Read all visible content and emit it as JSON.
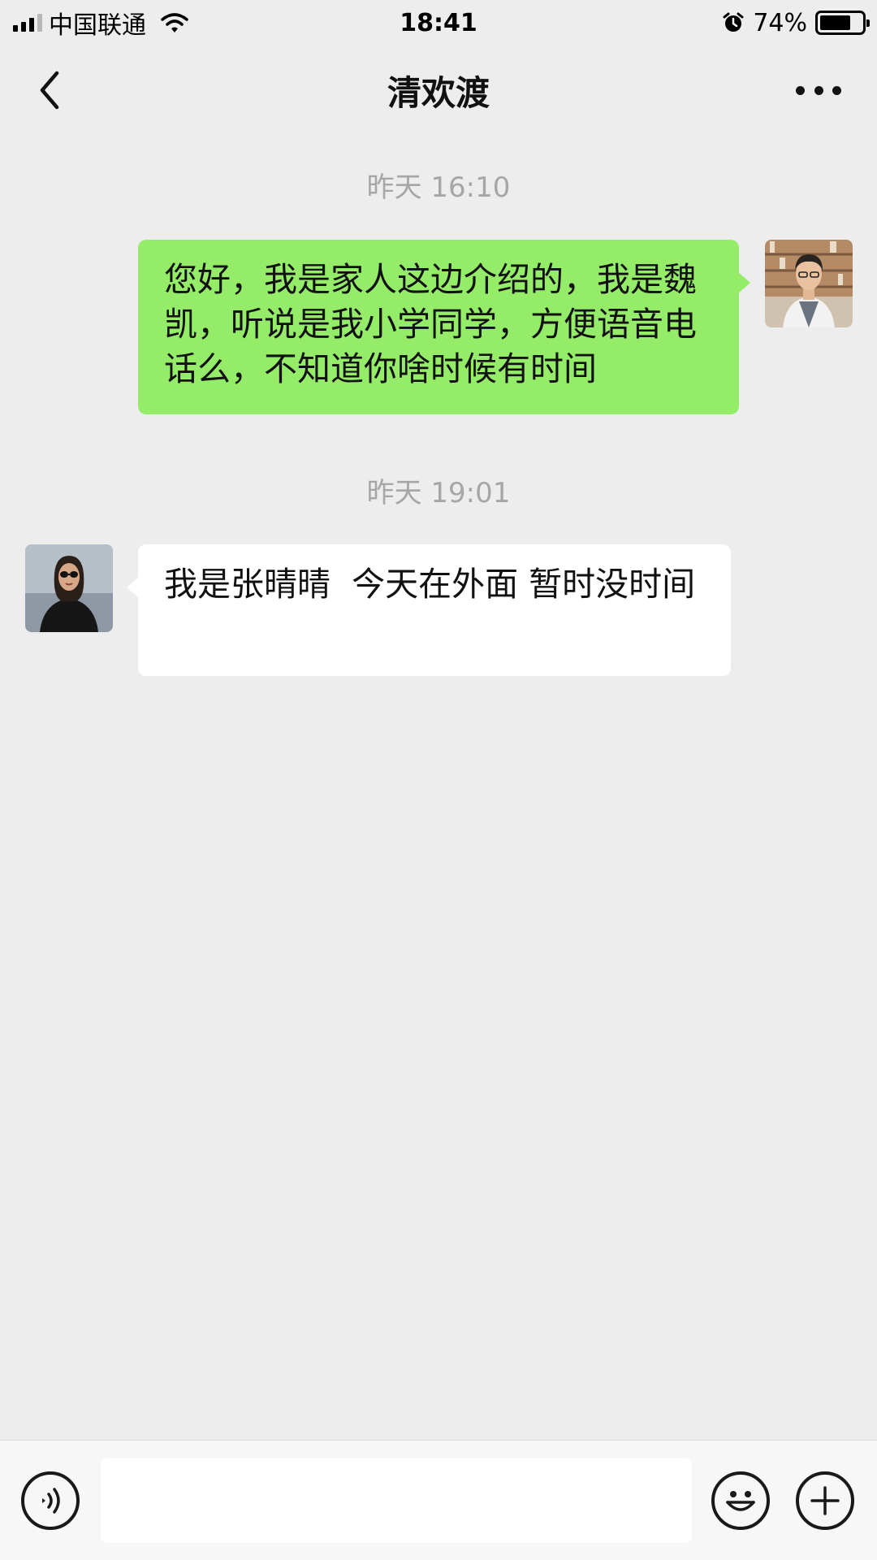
{
  "status_bar": {
    "carrier": "中国联通",
    "time": "18:41",
    "battery_percent": "74%",
    "battery_level": 0.74
  },
  "nav": {
    "title": "清欢渡"
  },
  "messages": [
    {
      "timestamp": "昨天 16:10",
      "direction": "sent",
      "text": "您好，我是家人这边介绍的，我是魏凯，听说是我小学同学，方便语音电话么，不知道你啥时候有时间"
    },
    {
      "timestamp": "昨天 19:01",
      "direction": "received",
      "text": "我是张晴晴  今天在外面 暂时没时间"
    }
  ],
  "input_bar": {
    "value": "",
    "icons": [
      "voice-icon",
      "emoji-icon",
      "plus-icon"
    ]
  },
  "colors": {
    "background": "#ededed",
    "sent_bubble": "#95ec69",
    "received_bubble": "#ffffff",
    "timestamp": "#a6a6a6"
  }
}
